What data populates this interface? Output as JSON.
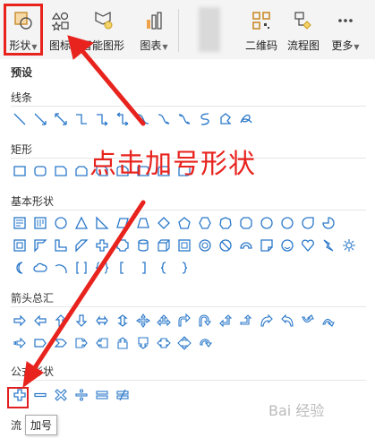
{
  "toolbar": {
    "shape_label": "形状",
    "icon_label": "图标",
    "smart_label": "智能图形",
    "chart_label": "图表",
    "qr_label": "二维码",
    "flow_label": "流程图",
    "more_label": "更多"
  },
  "panel": {
    "preset_label": "预设",
    "sections": {
      "lines": "线条",
      "rect": "矩形",
      "basic": "基本形状",
      "arrows": "箭头总汇",
      "formula": "公式形状",
      "flow": "流"
    }
  },
  "tooltip": "加号",
  "annotation": "点击加号形状",
  "watermark": "Bai 经验",
  "colors": {
    "accent": "#e8231e",
    "icon": "#2a78c9"
  }
}
